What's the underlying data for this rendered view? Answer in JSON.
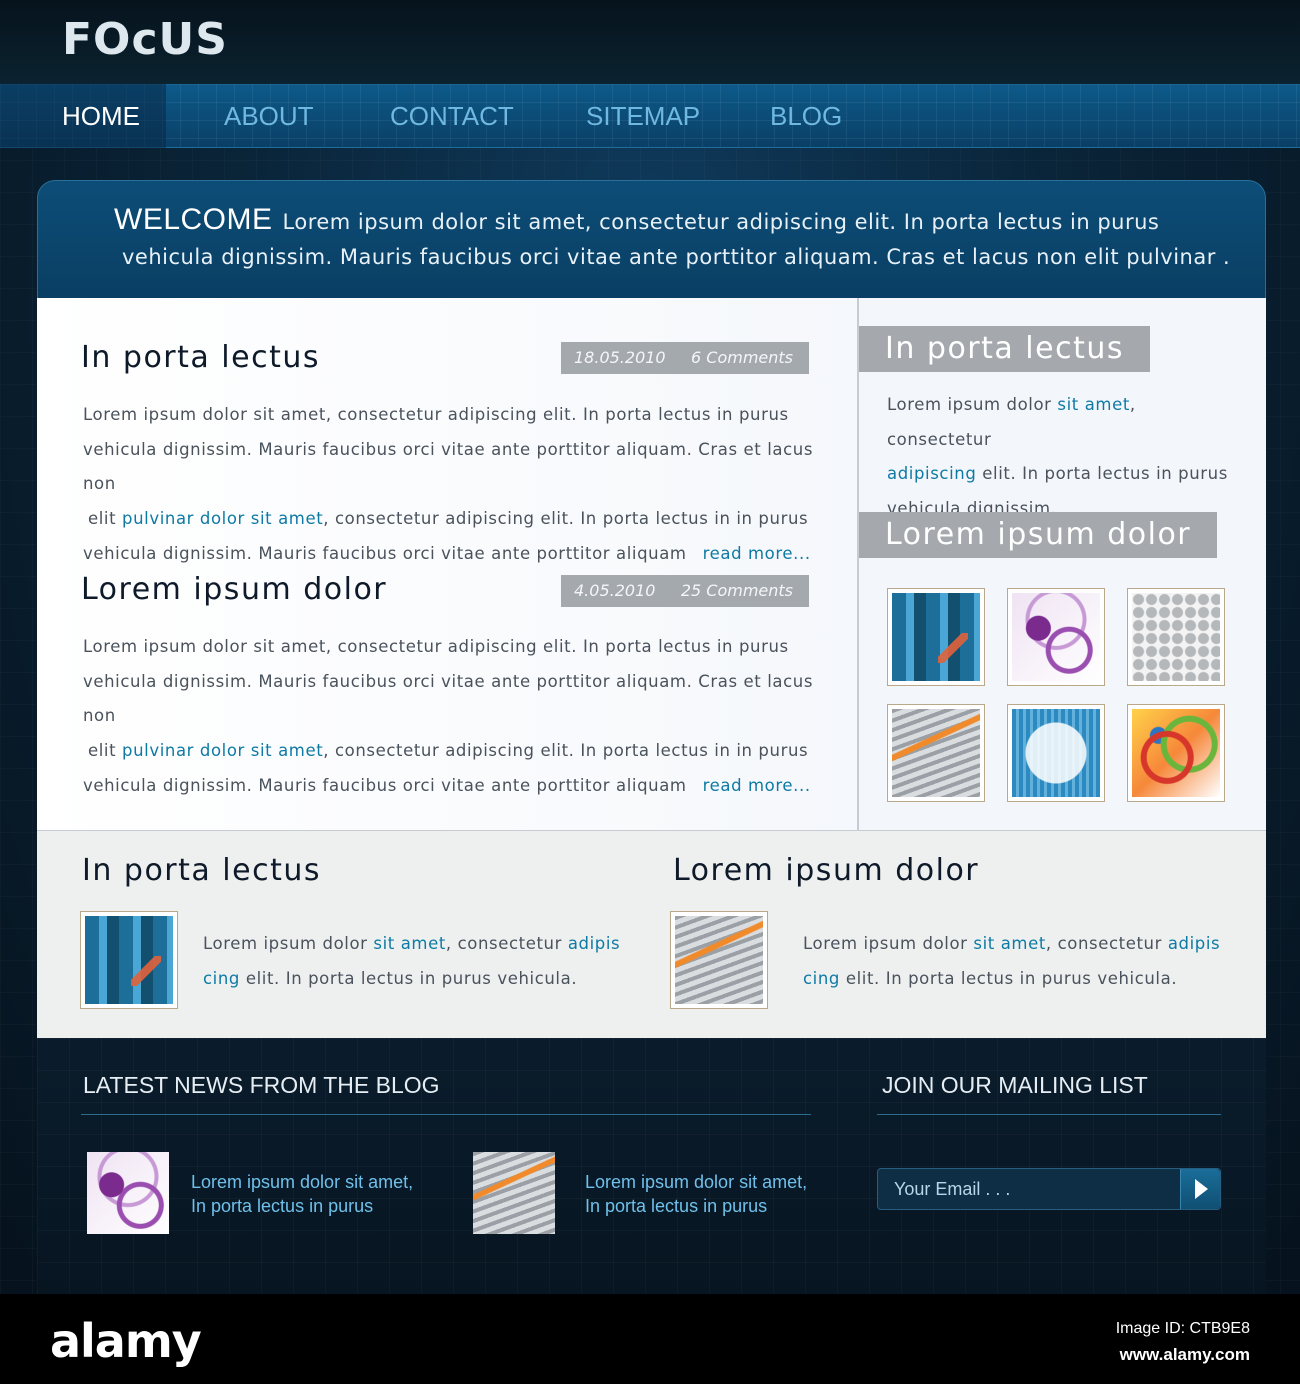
{
  "site": {
    "logo": "FOcUS"
  },
  "nav": {
    "items": [
      {
        "label": "HOME",
        "active": true
      },
      {
        "label": "ABOUT"
      },
      {
        "label": "CONTACT"
      },
      {
        "label": "SITEMAP"
      },
      {
        "label": "BLOG"
      }
    ]
  },
  "welcome": {
    "title": "WELCOME",
    "line1": "Lorem ipsum dolor sit amet, consectetur adipiscing elit. In porta lectus in purus",
    "line2": "vehicula dignissim. Mauris faucibus orci vitae ante porttitor aliquam. Cras et lacus non elit pulvinar ."
  },
  "posts": [
    {
      "title": "In porta lectus",
      "date": "18.05.2010",
      "comments": "6 Comments",
      "line1": "Lorem ipsum dolor sit amet, consectetur adipiscing elit. In porta lectus in purus",
      "line2": "vehicula dignissim. Mauris faucibus orci vitae ante porttitor aliquam. Cras et lacus non",
      "line3_pre": "elit ",
      "line3_link": "pulvinar dolor sit amet",
      "line3_post": ", consectetur adipiscing elit. In porta lectus in  in purus",
      "line4": "vehicula dignissim. Mauris faucibus orci vitae ante porttitor aliquam",
      "read_more": "read more..."
    },
    {
      "title": "Lorem ipsum dolor",
      "date": "4.05.2010",
      "comments": "25 Comments",
      "line1": "Lorem ipsum dolor sit amet, consectetur adipiscing elit. In porta lectus in purus",
      "line2": "vehicula dignissim. Mauris faucibus orci vitae ante porttitor aliquam. Cras et lacus non",
      "line3_pre": "elit ",
      "line3_link": "pulvinar dolor sit amet",
      "line3_post": ", consectetur adipiscing elit. In porta lectus in  in purus",
      "line4": "vehicula dignissim. Mauris faucibus orci vitae ante porttitor aliquam",
      "read_more": "read more..."
    }
  ],
  "sidebar": {
    "heading1": "In porta lectus",
    "text_a": "Lorem ipsum dolor ",
    "text_link1": "sit amet",
    "text_b": ", consectetur",
    "text_link2": "adipiscing",
    "text_c": " elit. In porta lectus in purus",
    "text_d": "vehicula dignissim.",
    "heading2": "Lorem ipsum dolor",
    "gallery_icons": [
      "blue-abstract-thumbnail",
      "purple-circles-thumbnail",
      "gray-dots-thumbnail",
      "road-arrow-thumbnail",
      "globe-thumbnail",
      "colorful-circles-thumbnail"
    ]
  },
  "features": [
    {
      "title": "In porta lectus",
      "text_a": "Lorem ipsum dolor ",
      "link1": "sit amet",
      "text_b": ", consectetur ",
      "link2": "adipis",
      "link3": "cing",
      "text_c": " elit. In porta lectus in purus vehicula."
    },
    {
      "title": "Lorem ipsum dolor",
      "text_a": "Lorem ipsum dolor ",
      "link1": "sit amet",
      "text_b": ", consectetur ",
      "link2": "adipis",
      "link3": "cing",
      "text_c": " elit. In porta lectus in purus vehicula."
    }
  ],
  "footer": {
    "blog_heading": "LATEST NEWS FROM THE BLOG",
    "mailing_heading": "JOIN OUR MAILING LIST",
    "blog_items": [
      {
        "line1": "Lorem ipsum dolor sit amet,",
        "line2": "In porta lectus in purus"
      },
      {
        "line1": "Lorem ipsum dolor sit amet,",
        "line2": "In porta lectus in purus"
      }
    ],
    "email_placeholder": "Your Email . . ."
  },
  "stock": {
    "logo": "alamy",
    "image_id": "Image ID: CTB9E8",
    "url": "www.alamy.com"
  },
  "colors": {
    "accent_link": "#0e7aa4",
    "nav_bg": "#0a3f66",
    "nav_text": "#6fb8e0"
  }
}
